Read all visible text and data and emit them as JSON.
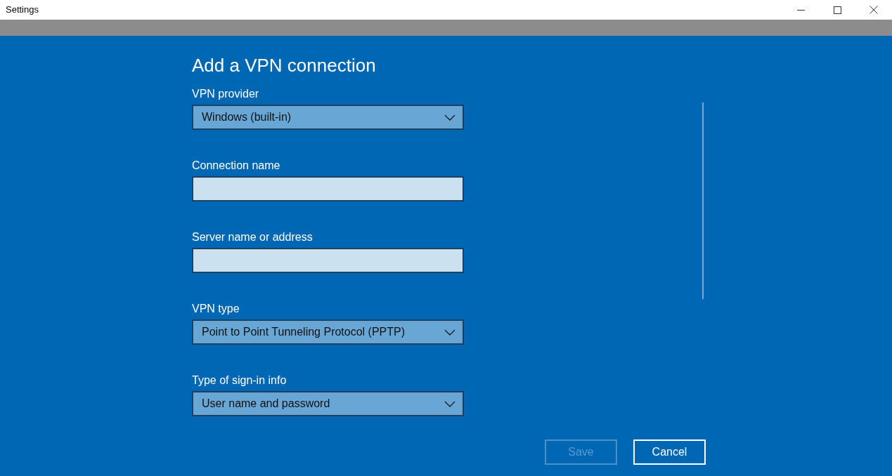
{
  "window": {
    "title": "Settings"
  },
  "heading": "Add a VPN connection",
  "fields": [
    {
      "kind": "dropdown",
      "label": "VPN provider",
      "value": "Windows (built-in)"
    },
    {
      "kind": "text",
      "label": "Connection name"
    },
    {
      "kind": "text",
      "label": "Server name or address"
    },
    {
      "kind": "dropdown",
      "label": "VPN type",
      "value": "Point to Point Tunneling Protocol (PPTP)"
    },
    {
      "kind": "dropdown",
      "label": "Type of sign-in info",
      "value": "User name and password"
    }
  ],
  "buttons": [
    {
      "label": "Save",
      "disabled": true
    },
    {
      "label": "Cancel",
      "disabled": false
    }
  ]
}
